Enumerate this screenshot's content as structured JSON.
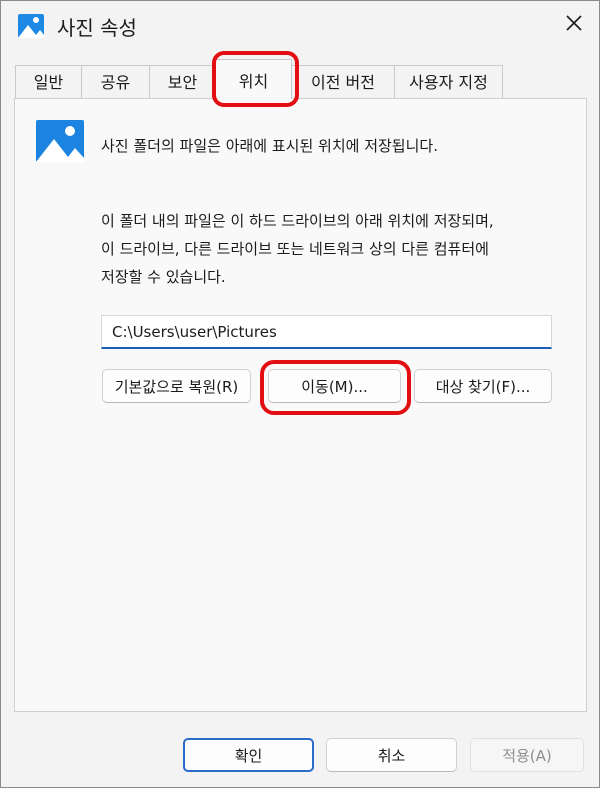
{
  "window": {
    "title": "사진 속성",
    "title_icon": "photo-folder-icon",
    "close_icon": "close-icon"
  },
  "tabs": [
    {
      "label": "일반",
      "active": false
    },
    {
      "label": "공유",
      "active": false
    },
    {
      "label": "보안",
      "active": false
    },
    {
      "label": "위치",
      "active": true
    },
    {
      "label": "이전 버전",
      "active": false
    },
    {
      "label": "사용자 지정",
      "active": false
    }
  ],
  "location": {
    "icon": "photo-folder-icon",
    "description": "사진 폴더의 파일은 아래에 표시된 위치에 저장됩니다.",
    "details": [
      "이 폴더 내의 파일은 이 하드 드라이브의 아래 위치에 저장되며,",
      "이 드라이브, 다른 드라이브 또는 네트워크 상의 다른 컴퓨터에",
      "저장할 수 있습니다."
    ],
    "path_value": "C:\\Users\\user\\Pictures",
    "restore_default_label": "기본값으로 복원(R)",
    "move_label": "이동(M)...",
    "find_target_label": "대상 찾기(F)..."
  },
  "footer": {
    "ok_label": "확인",
    "cancel_label": "취소",
    "apply_label": "적용(A)",
    "apply_enabled": false
  },
  "colors": {
    "accent": "#2a6cc7",
    "highlight_annotation": "#e20e12",
    "icon_blue": "#1e88e5"
  }
}
